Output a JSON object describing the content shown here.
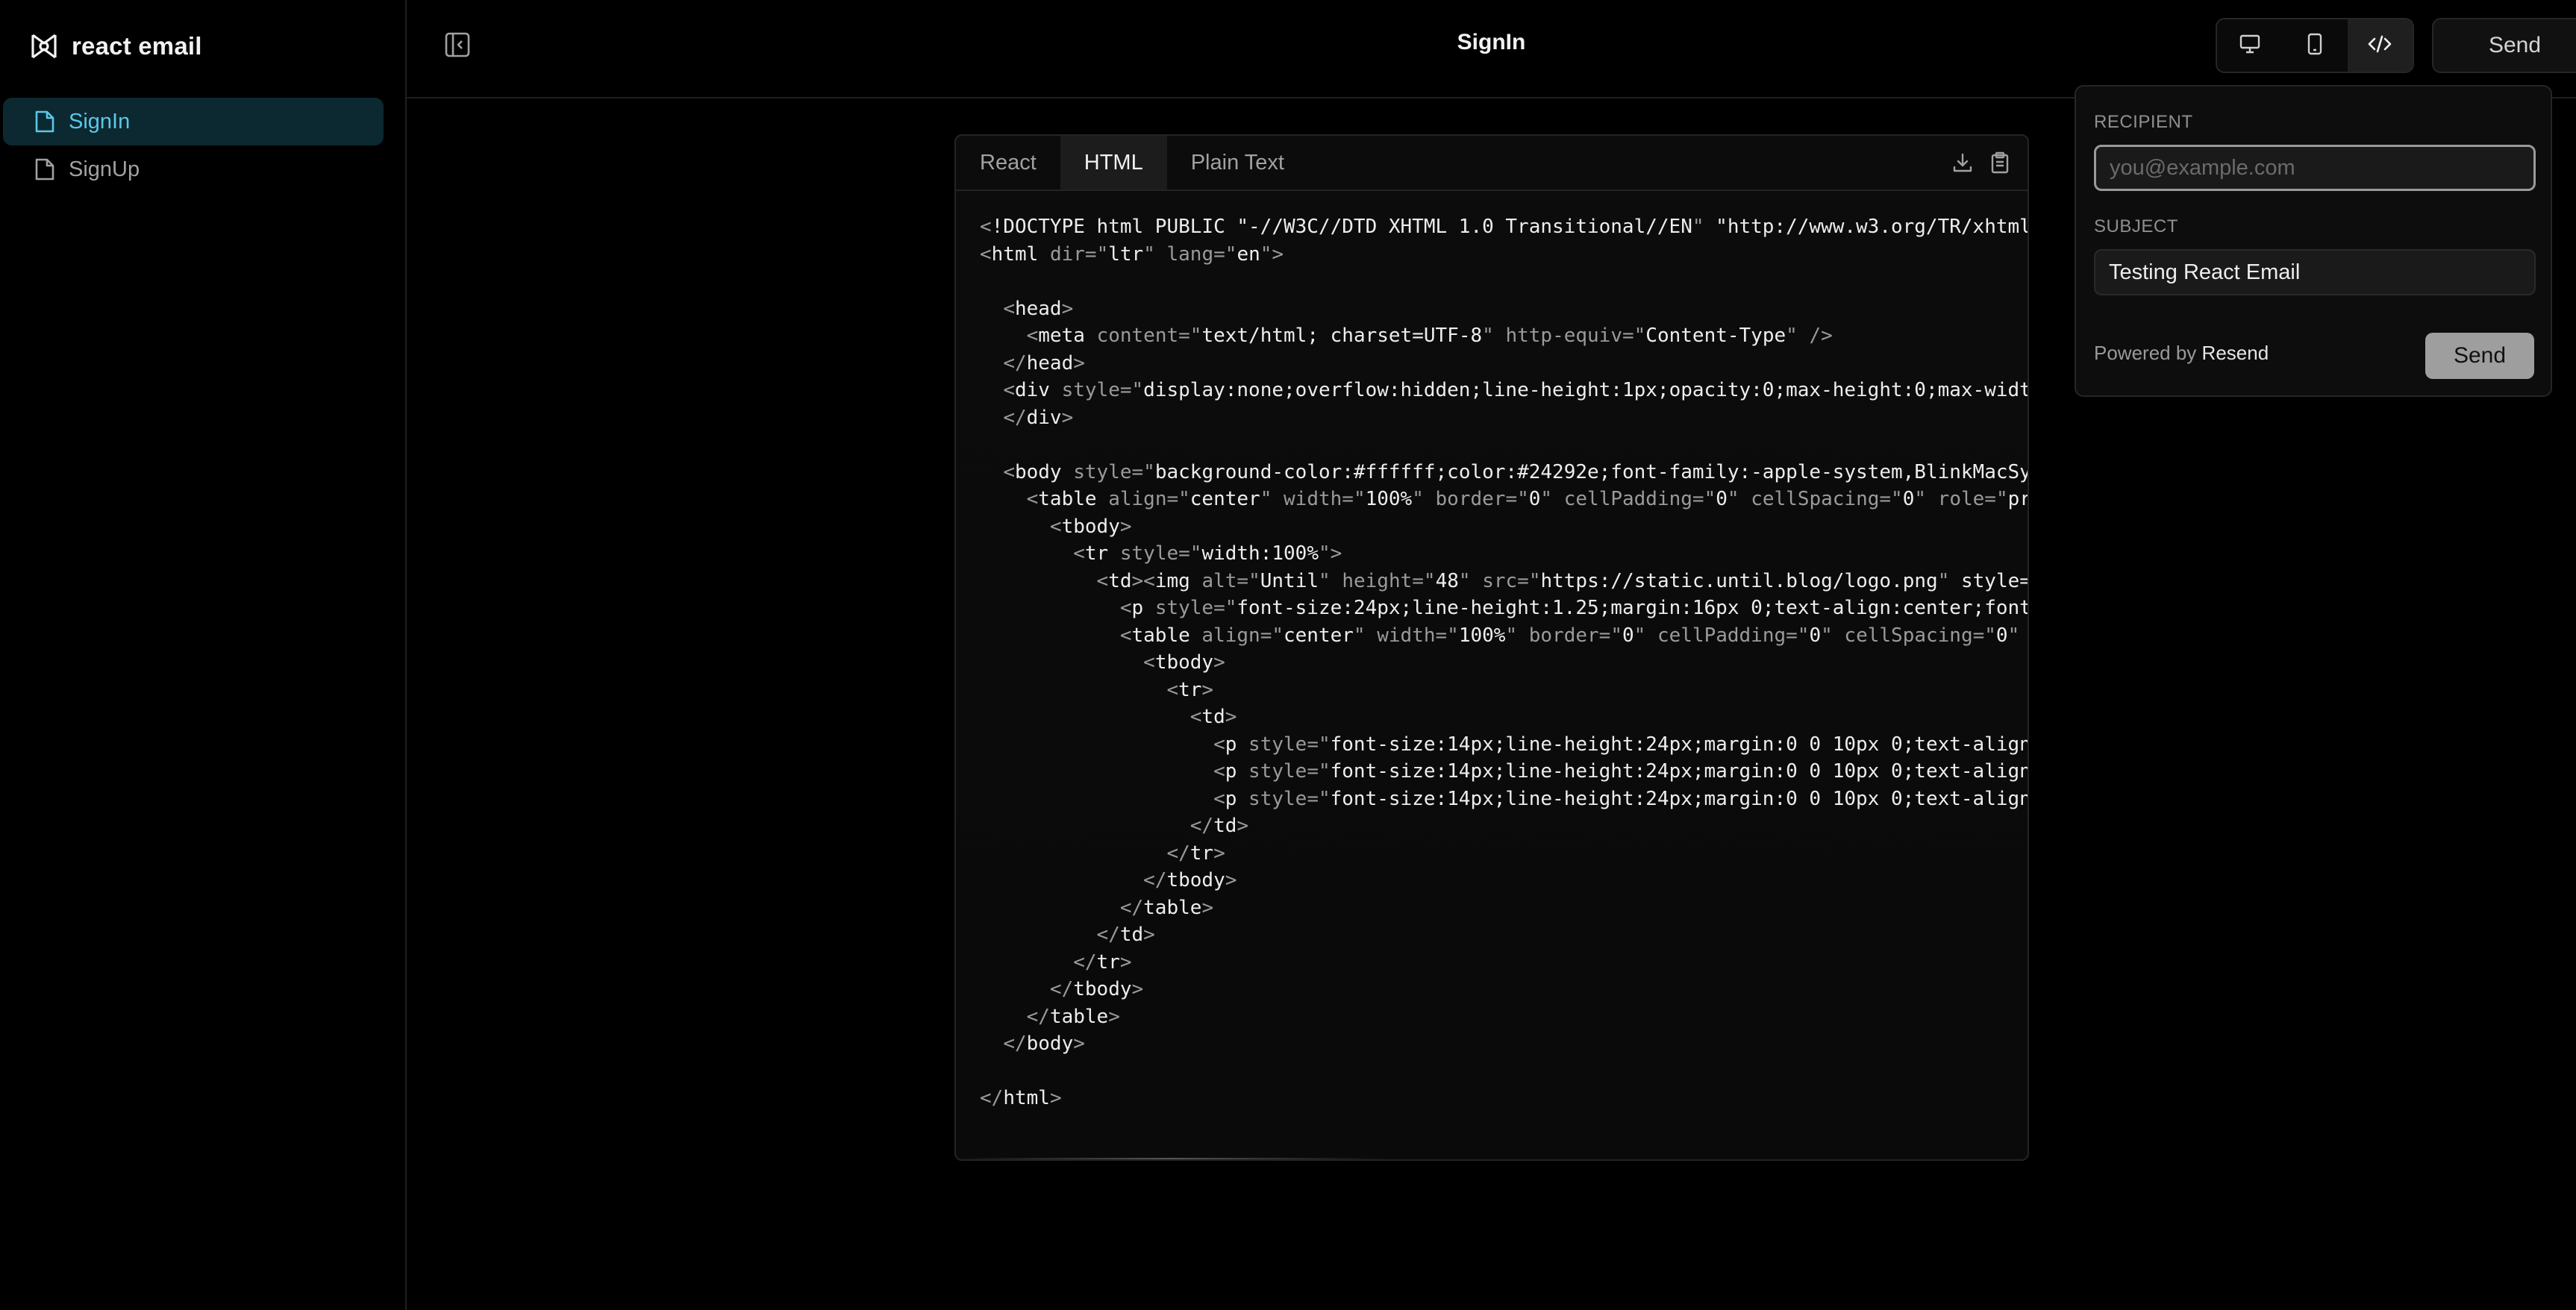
{
  "app": {
    "name": "react email",
    "page_title": "SignIn"
  },
  "sidebar": {
    "items": [
      {
        "label": "SignIn",
        "active": true,
        "icon": "file-icon"
      },
      {
        "label": "SignUp",
        "active": false,
        "icon": "file-icon"
      }
    ]
  },
  "toolbar": {
    "views": [
      {
        "name": "desktop-view",
        "icon": "monitor-icon",
        "active": false
      },
      {
        "name": "mobile-view",
        "icon": "smartphone-icon",
        "active": false
      },
      {
        "name": "code-view",
        "icon": "code-icon",
        "active": true
      }
    ],
    "send_label": "Send"
  },
  "code_panel": {
    "tabs": [
      {
        "label": "React",
        "active": false
      },
      {
        "label": "HTML",
        "active": true
      },
      {
        "label": "Plain Text",
        "active": false
      }
    ],
    "lines": [
      "<!DOCTYPE html PUBLIC \"-//W3C//DTD XHTML 1.0 Transitional//EN\" \"http://www.w3.org/TR/xhtml",
      "<html dir=\"ltr\" lang=\"en\">",
      "",
      "  <head>",
      "    <meta content=\"text/html; charset=UTF-8\" http-equiv=\"Content-Type\" />",
      "  </head>",
      "  <div style=\"display:none;overflow:hidden;line-height:1px;opacity:0;max-height:0;max-widt",
      "  </div>",
      "",
      "  <body style=\"background-color:#ffffff;color:#24292e;font-family:-apple-system,BlinkMacSy",
      "    <table align=\"center\" width=\"100%\" border=\"0\" cellPadding=\"0\" cellSpacing=\"0\" role=\"pr",
      "      <tbody>",
      "        <tr style=\"width:100%\">",
      "          <td><img alt=\"Until\" height=\"48\" src=\"https://static.until.blog/logo.png\" style=",
      "            <p style=\"font-size:24px;line-height:1.25;margin:16px 0;text-align:center;font",
      "            <table align=\"center\" width=\"100%\" border=\"0\" cellPadding=\"0\" cellSpacing=\"0\"",
      "              <tbody>",
      "                <tr>",
      "                  <td>",
      "                    <p style=\"font-size:14px;line-height:24px;margin:0 0 10px 0;text-align",
      "                    <p style=\"font-size:14px;line-height:24px;margin:0 0 10px 0;text-align",
      "                    <p style=\"font-size:14px;line-height:24px;margin:0 0 10px 0;text-align",
      "                  </td>",
      "                </tr>",
      "              </tbody>",
      "            </table>",
      "          </td>",
      "        </tr>",
      "      </tbody>",
      "    </table>",
      "  </body>",
      "",
      "</html>"
    ]
  },
  "send_popover": {
    "recipient_label": "RECIPIENT",
    "recipient_placeholder": "you@example.com",
    "recipient_value": "",
    "subject_label": "SUBJECT",
    "subject_value": "Testing React Email",
    "powered_by_prefix": "Powered by",
    "powered_by_brand": "Resend",
    "send_label": "Send"
  },
  "colors": {
    "active_nav_bg": "#0c2830",
    "active_nav_text": "#5ac8e6",
    "background": "#000000"
  }
}
